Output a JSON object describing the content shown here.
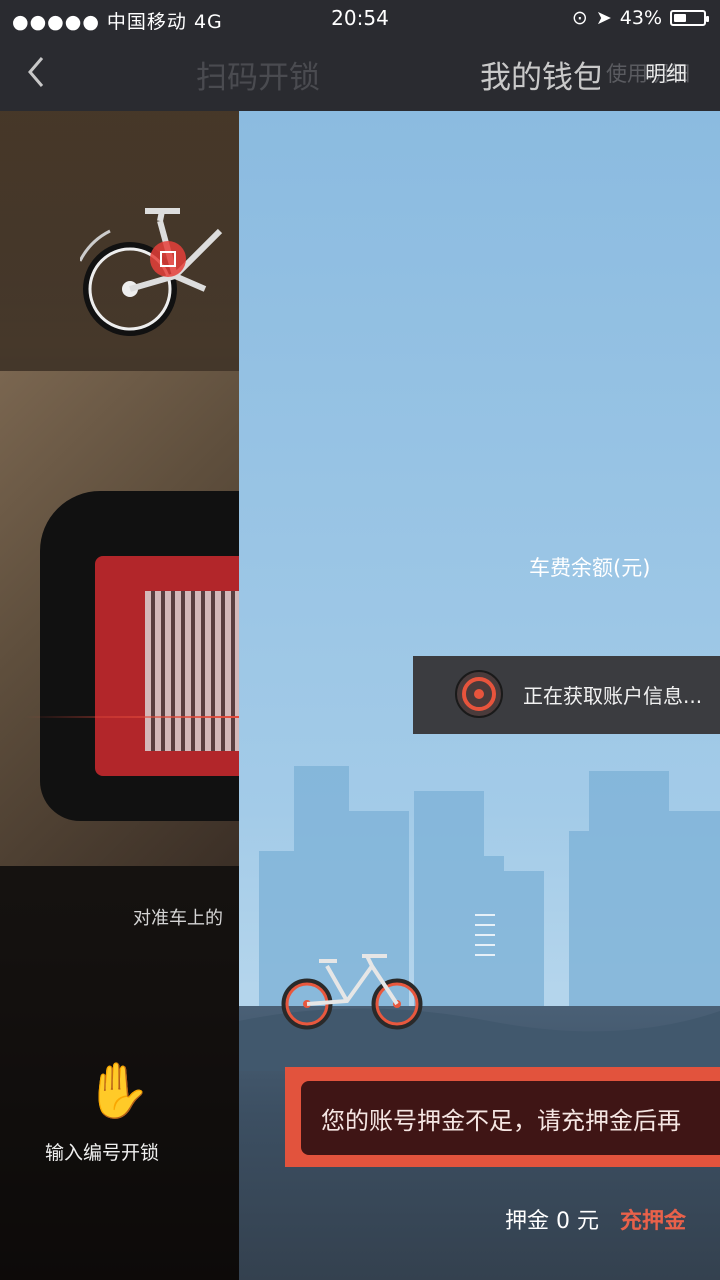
{
  "status_bar": {
    "signal": "●●●●● 中国移动  4G",
    "time": "20:54",
    "battery": "43%",
    "battery_level": 0.43
  },
  "nav": {
    "back_icon": "chevron-left-icon",
    "left_title": "扫码开锁",
    "right_title": "我的钱包",
    "detail_behind": "使用明细",
    "detail_front": "明细"
  },
  "scan_panel": {
    "align_hint": "对准车上的",
    "manual_unlock": "输入编号开锁"
  },
  "wallet": {
    "balance_label": "车费余额(元)",
    "loading_toast": "正在获取账户信息...",
    "alert": "您的账号押金不足，请充押金后再",
    "deposit_text": "押金 0 元",
    "recharge_link": "充押金"
  },
  "colors": {
    "accent": "#e9614a",
    "nav_bg": "#2a2b30",
    "sky": "#8bbbe0"
  }
}
